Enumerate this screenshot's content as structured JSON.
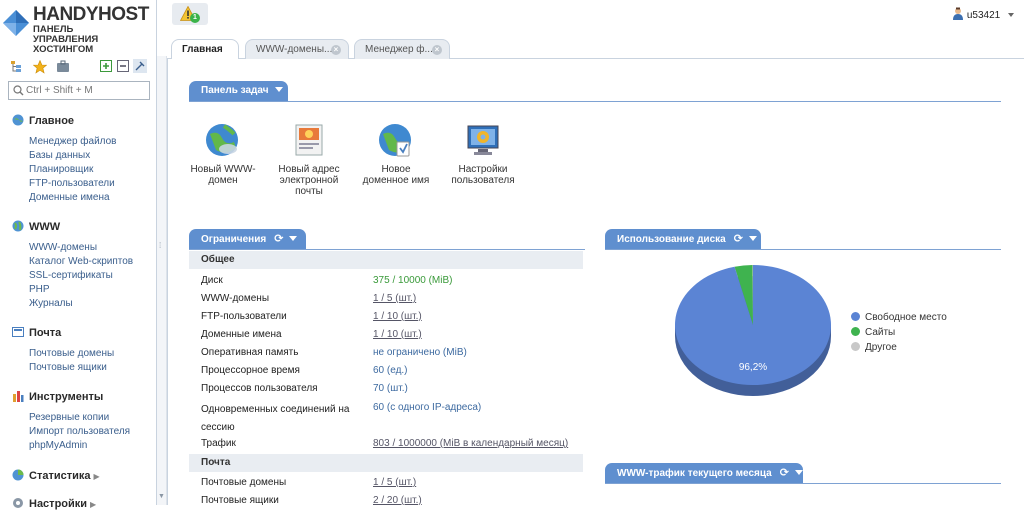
{
  "brand": {
    "name": "HANDYHOST",
    "subtitle_lines": [
      "ПАНЕЛЬ",
      "УПРАВЛЕНИЯ",
      "ХОСТИНГОМ"
    ]
  },
  "search": {
    "placeholder": "Ctrl + Shift + M"
  },
  "sidebar": {
    "sections": [
      {
        "title": "Главное",
        "icon": "home-globe-icon",
        "items": [
          "Менеджер файлов",
          "Базы данных",
          "Планировщик",
          "FTP-пользователи",
          "Доменные имена"
        ]
      },
      {
        "title": "WWW",
        "icon": "globe-icon",
        "items": [
          "WWW-домены",
          "Каталог Web-скриптов",
          "SSL-сертификаты",
          "PHP",
          "Журналы"
        ]
      },
      {
        "title": "Почта",
        "icon": "mail-icon",
        "items": [
          "Почтовые домены",
          "Почтовые ящики"
        ]
      },
      {
        "title": "Инструменты",
        "icon": "tools-icon",
        "items": [
          "Резервные копии",
          "Импорт пользователя",
          "phpMyAdmin"
        ]
      },
      {
        "title": "Статистика",
        "icon": "stats-icon",
        "items": []
      },
      {
        "title": "Настройки",
        "icon": "settings-icon",
        "items": []
      }
    ]
  },
  "topbar": {
    "warning_count": "1",
    "username": "u53421"
  },
  "tabs": [
    {
      "label": "Главная",
      "active": true
    },
    {
      "label": "WWW-домены...",
      "active": false
    },
    {
      "label": "Менеджер ф...",
      "active": false
    }
  ],
  "taskbar": {
    "title": "Панель задач",
    "items": [
      {
        "label": "Новый WWW-домен",
        "icon": "www-globe-icon"
      },
      {
        "label": "Новый адрес электронной почты",
        "icon": "mail-address-icon"
      },
      {
        "label": "Новое доменное имя",
        "icon": "domain-globe-icon"
      },
      {
        "label": "Настройки пользователя",
        "icon": "user-settings-icon"
      }
    ]
  },
  "limits": {
    "title": "Ограничения",
    "groups": [
      {
        "name": "Общее",
        "rows": [
          {
            "label": "Диск",
            "value": "375 / 10000 (MiB)",
            "style": "green"
          },
          {
            "label": "WWW-домены",
            "value": "1 / 5 (шт.)",
            "style": "link"
          },
          {
            "label": "FTP-пользователи",
            "value": "1 / 10 (шт.)",
            "style": "link"
          },
          {
            "label": "Доменные имена",
            "value": "1 / 10 (шт.)",
            "style": "link"
          },
          {
            "label": "Оперативная память",
            "value": "не ограничено (MiB)",
            "style": "plain"
          },
          {
            "label": "Процессорное время",
            "value": "60 (ед.)",
            "style": "plain"
          },
          {
            "label": "Процессов пользователя",
            "value": "70 (шт.)",
            "style": "plain"
          },
          {
            "label": "Одновременных соединений на сессию",
            "value": "60 (с одного IP-адреса)",
            "style": "plain"
          },
          {
            "label": "Трафик",
            "value": "803 / 1000000 (MiB в календарный месяц)",
            "style": "link"
          }
        ]
      },
      {
        "name": "Почта",
        "rows": [
          {
            "label": "Почтовые домены",
            "value": "1 / 5 (шт.)",
            "style": "link"
          },
          {
            "label": "Почтовые ящики",
            "value": "2 / 20 (шт.)",
            "style": "link"
          }
        ]
      }
    ]
  },
  "disk": {
    "title": "Использование диска",
    "legend": [
      {
        "label": "Свободное место",
        "color": "#5b84d4"
      },
      {
        "label": "Сайты",
        "color": "#3fb34f"
      },
      {
        "label": "Другое",
        "color": "#c8c8c8"
      }
    ],
    "slice_label": "96,2%",
    "chart_data": {
      "type": "pie",
      "categories": [
        "Свободное место",
        "Сайты",
        "Другое"
      ],
      "values": [
        96.2,
        3.7,
        0.1
      ]
    }
  },
  "traffic": {
    "title": "WWW-трафик текущего месяца"
  }
}
